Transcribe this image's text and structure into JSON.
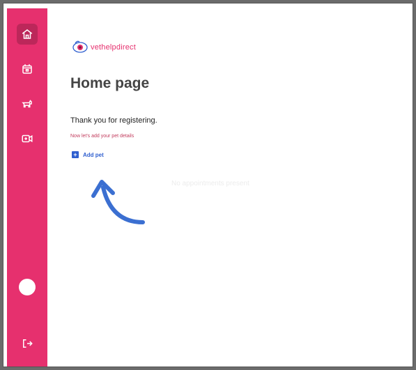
{
  "sidebar": {
    "items": [
      {
        "icon": "home-icon"
      },
      {
        "icon": "calendar-icon"
      },
      {
        "icon": "pet-icon"
      },
      {
        "icon": "video-call-icon"
      }
    ],
    "bottom": {
      "avatar": "avatar",
      "logout_icon": "logout-icon"
    }
  },
  "brand": {
    "logo_text": "vethelpdirect",
    "accent_color": "#e6306e"
  },
  "page": {
    "title": "Home page",
    "thanks": "Thank you for registering.",
    "subtext": "Now let's add your pet details",
    "add_pet_label": "Add pet",
    "add_pet_icon": "+",
    "empty_state": "No appointments present"
  },
  "colors": {
    "sidebar": "#e6306e",
    "link": "#2f5fcf",
    "arrow": "#3b6fd1"
  }
}
